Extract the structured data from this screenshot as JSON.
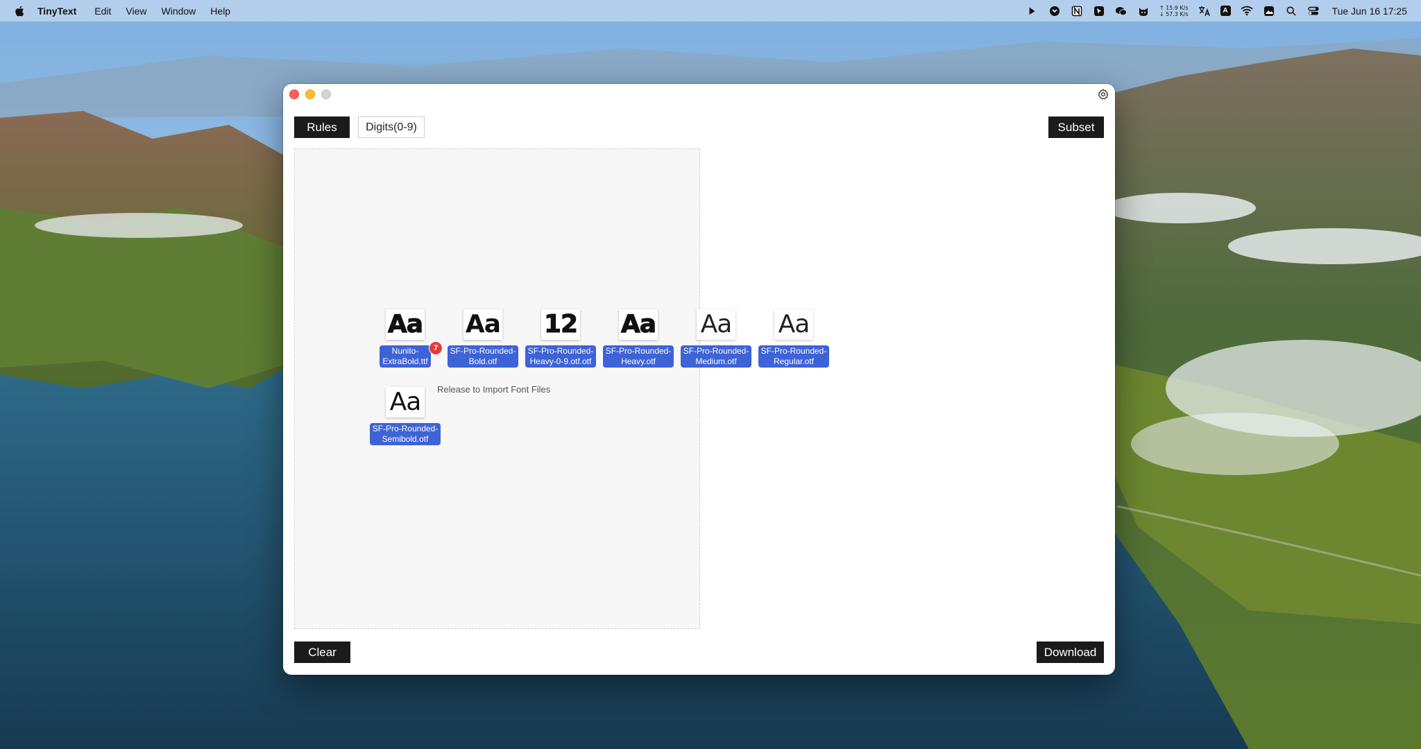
{
  "menubar": {
    "app_name": "TinyText",
    "menus": [
      "Edit",
      "View",
      "Window",
      "Help"
    ],
    "status_icons": [
      "terminal-icon",
      "screenshot-icon",
      "notion-icon",
      "cursor-icon",
      "wechat-icon",
      "cat-icon"
    ],
    "net_up": "↑ 15.9 K/s",
    "net_down": "↓ 57.3 K/s",
    "input_badge": "A",
    "clock": "Tue Jun 16  17:25"
  },
  "window": {
    "rules_label": "Rules",
    "digits_tag": "Digits(0-9)",
    "subset_label": "Subset",
    "clear_label": "Clear",
    "download_label": "Download",
    "drop_hint": "Release to Import Font Files",
    "drag_count": "7",
    "files": [
      {
        "preview": "Aa",
        "line1": "Nunito-",
        "line2": "ExtraBold.ttf",
        "weight": "800"
      },
      {
        "preview": "Aa",
        "line1": "SF-Pro-Rounded-",
        "line2": "Bold.otf",
        "weight": "700"
      },
      {
        "preview": "12",
        "line1": "SF-Pro-Rounded-",
        "line2": "Heavy-0-9.otf.otf",
        "weight": "900"
      },
      {
        "preview": "Aa",
        "line1": "SF-Pro-Rounded-",
        "line2": "Heavy.otf",
        "weight": "900"
      },
      {
        "preview": "Aa",
        "line1": "SF-Pro-Rounded-",
        "line2": "Medium.otf",
        "weight": "500"
      },
      {
        "preview": "Aa",
        "line1": "SF-Pro-Rounded-",
        "line2": "Regular.otf",
        "weight": "400"
      },
      {
        "preview": "Aa",
        "line1": "SF-Pro-Rounded-",
        "line2": "Semibold.otf",
        "weight": "600"
      }
    ]
  },
  "colors": {
    "accent_label": "#3d63d6",
    "button_dark": "#1b1b1b",
    "badge_red": "#e33b3b"
  }
}
